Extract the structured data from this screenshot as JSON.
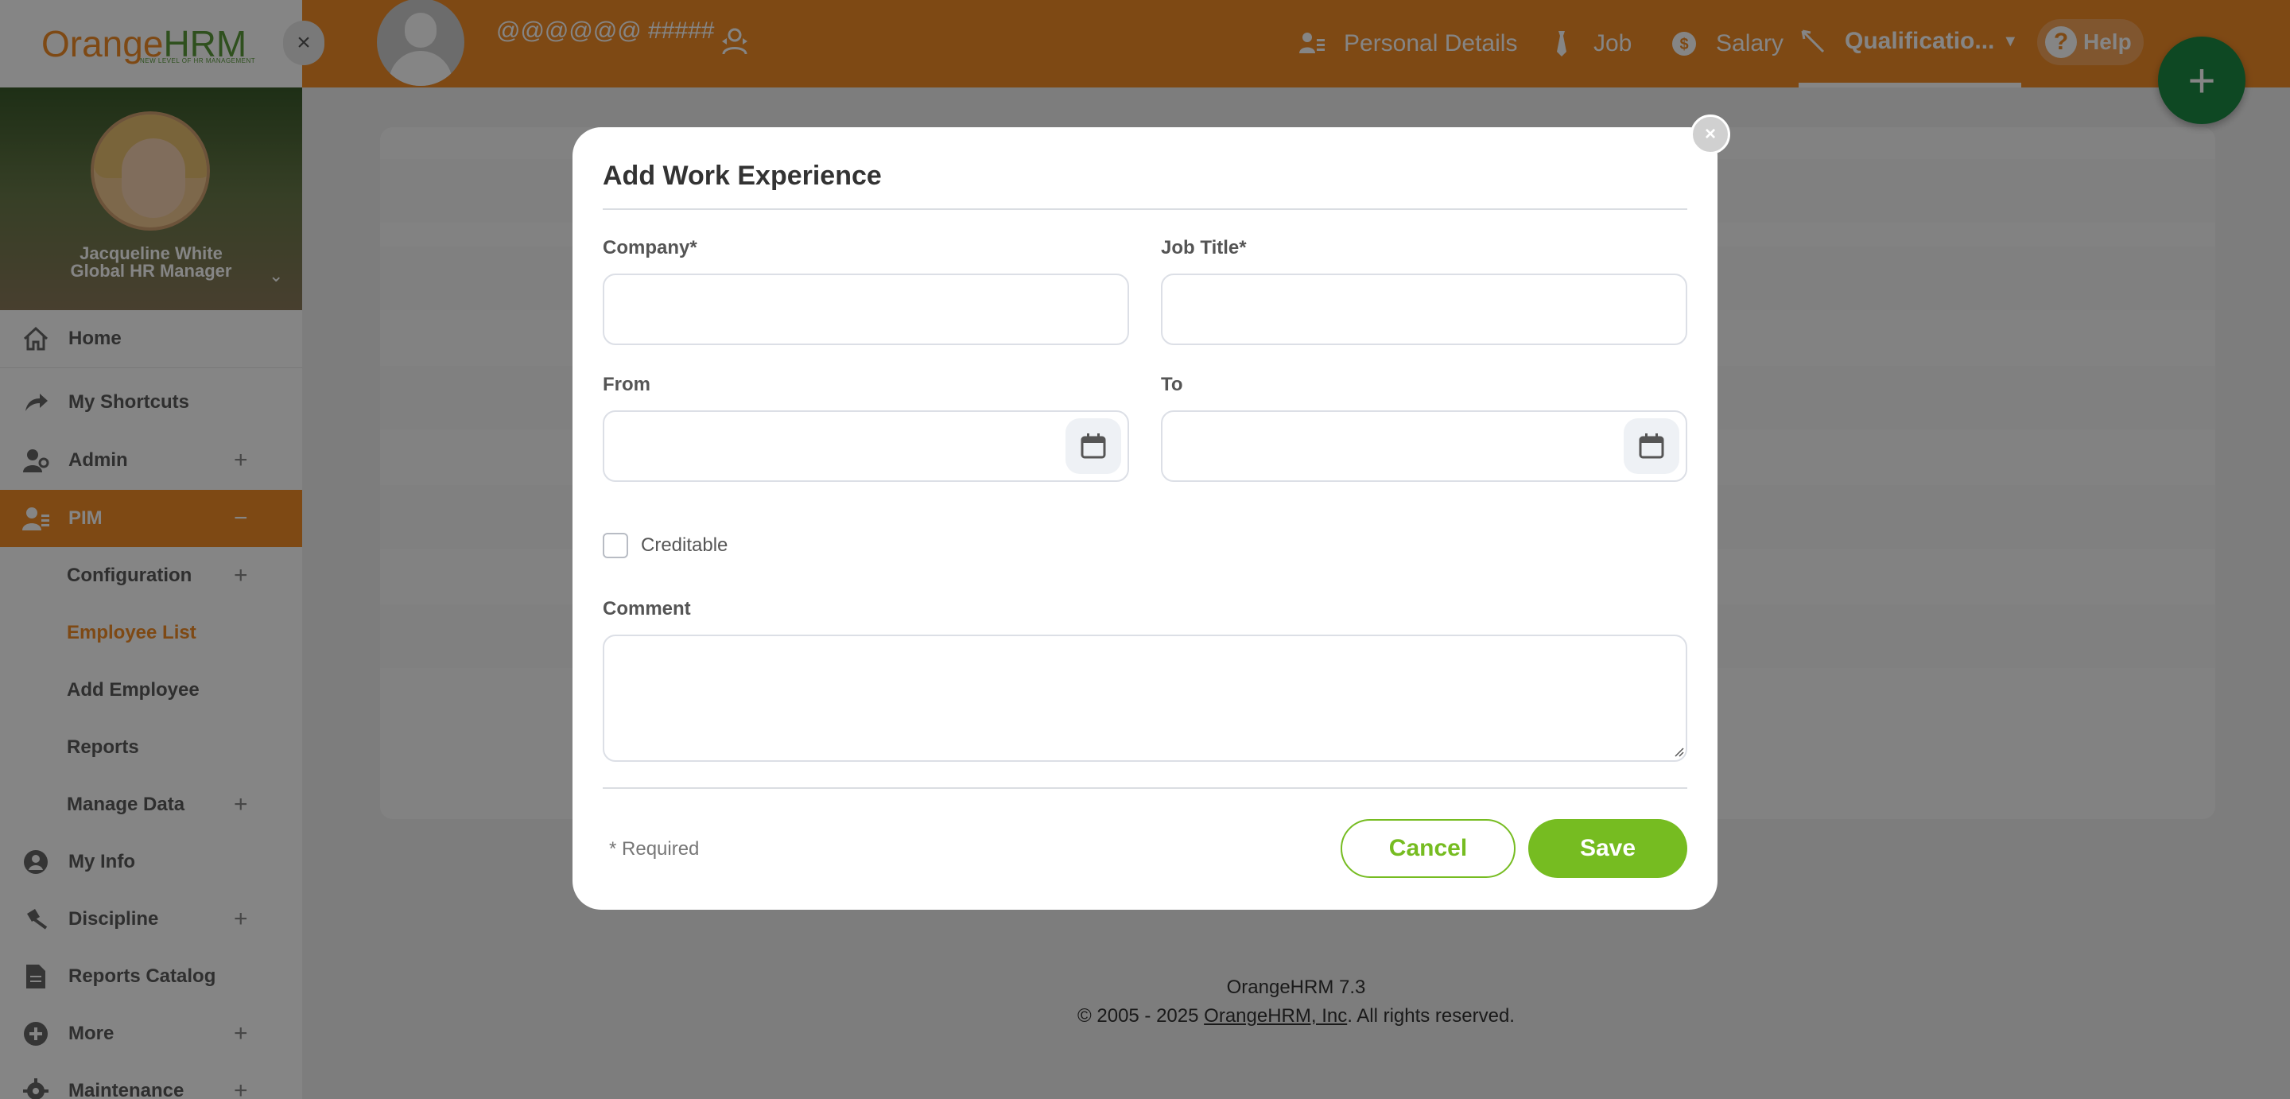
{
  "app": {
    "logo_main": "Orange",
    "logo_accent": "HRM",
    "logo_tagline": "NEW LEVEL OF HR MANAGEMENT"
  },
  "header": {
    "employee_name": "@@@@@@ #####",
    "tabs": [
      {
        "label": "Personal Details",
        "icon": "person-details-icon"
      },
      {
        "label": "Job",
        "icon": "tie-icon"
      },
      {
        "label": "Salary",
        "icon": "money-icon"
      },
      {
        "label": "Qualificatio...",
        "icon": "pen-icon",
        "active": true
      }
    ],
    "help_label": "Help",
    "add_label": "+"
  },
  "sidebar": {
    "user_name": "Jacqueline White",
    "user_role": "Global HR Manager",
    "items": [
      {
        "label": "Home",
        "icon": "home-icon",
        "expandable": false
      },
      {
        "label": "My Shortcuts",
        "icon": "share-arrow-icon",
        "expandable": false
      },
      {
        "label": "Admin",
        "icon": "admin-user-icon",
        "expandable": true
      },
      {
        "label": "PIM",
        "icon": "pim-user-icon",
        "expandable": true,
        "active": true
      }
    ],
    "pim_sub": [
      {
        "label": "Configuration",
        "expandable": true
      },
      {
        "label": "Employee List",
        "expandable": false,
        "active": true
      },
      {
        "label": "Add Employee",
        "expandable": false
      },
      {
        "label": "Reports",
        "expandable": false
      },
      {
        "label": "Manage Data",
        "expandable": true
      }
    ],
    "items_after": [
      {
        "label": "My Info",
        "icon": "user-circle-icon",
        "expandable": false
      },
      {
        "label": "Discipline",
        "icon": "gavel-icon",
        "expandable": true
      },
      {
        "label": "Reports Catalog",
        "icon": "document-icon",
        "expandable": false
      },
      {
        "label": "More",
        "icon": "plus-circle-icon",
        "expandable": true
      },
      {
        "label": "Maintenance",
        "icon": "gear-icon",
        "expandable": true
      }
    ],
    "plus_symbol": "+",
    "minus_symbol": "−"
  },
  "footer": {
    "version": "OrangeHRM 7.3",
    "copyright_prefix": "© 2005 - 2025 ",
    "company_link": "OrangeHRM, Inc",
    "copyright_suffix": ". All rights reserved."
  },
  "modal": {
    "title": "Add Work Experience",
    "company_label": "Company*",
    "company_value": "",
    "job_title_label": "Job Title*",
    "job_title_value": "",
    "from_label": "From",
    "from_value": "",
    "to_label": "To",
    "to_value": "",
    "creditable_label": "Creditable",
    "creditable_checked": false,
    "comment_label": "Comment",
    "comment_value": "",
    "required_note": "* Required",
    "cancel_label": "Cancel",
    "save_label": "Save",
    "close_symbol": "×"
  },
  "colors": {
    "brand_orange": "#f28c28",
    "brand_green": "#76bc21",
    "fab_green": "#1c8a44"
  }
}
